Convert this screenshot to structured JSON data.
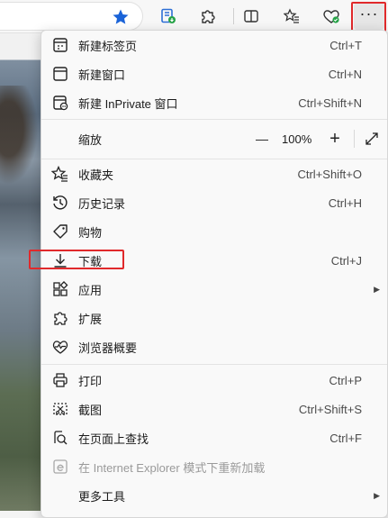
{
  "menu": {
    "new_tab": {
      "label": "新建标签页",
      "shortcut": "Ctrl+T"
    },
    "new_window": {
      "label": "新建窗口",
      "shortcut": "Ctrl+N"
    },
    "new_inprivate": {
      "label": "新建 InPrivate 窗口",
      "shortcut": "Ctrl+Shift+N"
    },
    "zoom": {
      "label": "缩放",
      "minus": "—",
      "value": "100%",
      "plus": "+"
    },
    "favorites": {
      "label": "收藏夹",
      "shortcut": "Ctrl+Shift+O"
    },
    "history": {
      "label": "历史记录",
      "shortcut": "Ctrl+H"
    },
    "shopping": {
      "label": "购物"
    },
    "downloads": {
      "label": "下载",
      "shortcut": "Ctrl+J"
    },
    "apps": {
      "label": "应用"
    },
    "extensions": {
      "label": "扩展"
    },
    "browser_essentials": {
      "label": "浏览器概要"
    },
    "print": {
      "label": "打印",
      "shortcut": "Ctrl+P"
    },
    "screenshot": {
      "label": "截图",
      "shortcut": "Ctrl+Shift+S"
    },
    "find": {
      "label": "在页面上查找",
      "shortcut": "Ctrl+F"
    },
    "ie_mode": {
      "label": "在 Internet Explorer 模式下重新加载"
    },
    "more_tools": {
      "label": "更多工具"
    }
  },
  "toolbar": {
    "more_label": "···",
    "icons": [
      "favorite-star-icon",
      "reading-shield-icon",
      "extensions-puzzle-icon",
      "split-screen-icon",
      "favorites-list-icon",
      "browser-essentials-icon",
      "more-options-icon"
    ]
  },
  "colors": {
    "accent": "#1a63d8",
    "highlight": "#e0292b",
    "menu_bg": "#f9f9f9"
  }
}
